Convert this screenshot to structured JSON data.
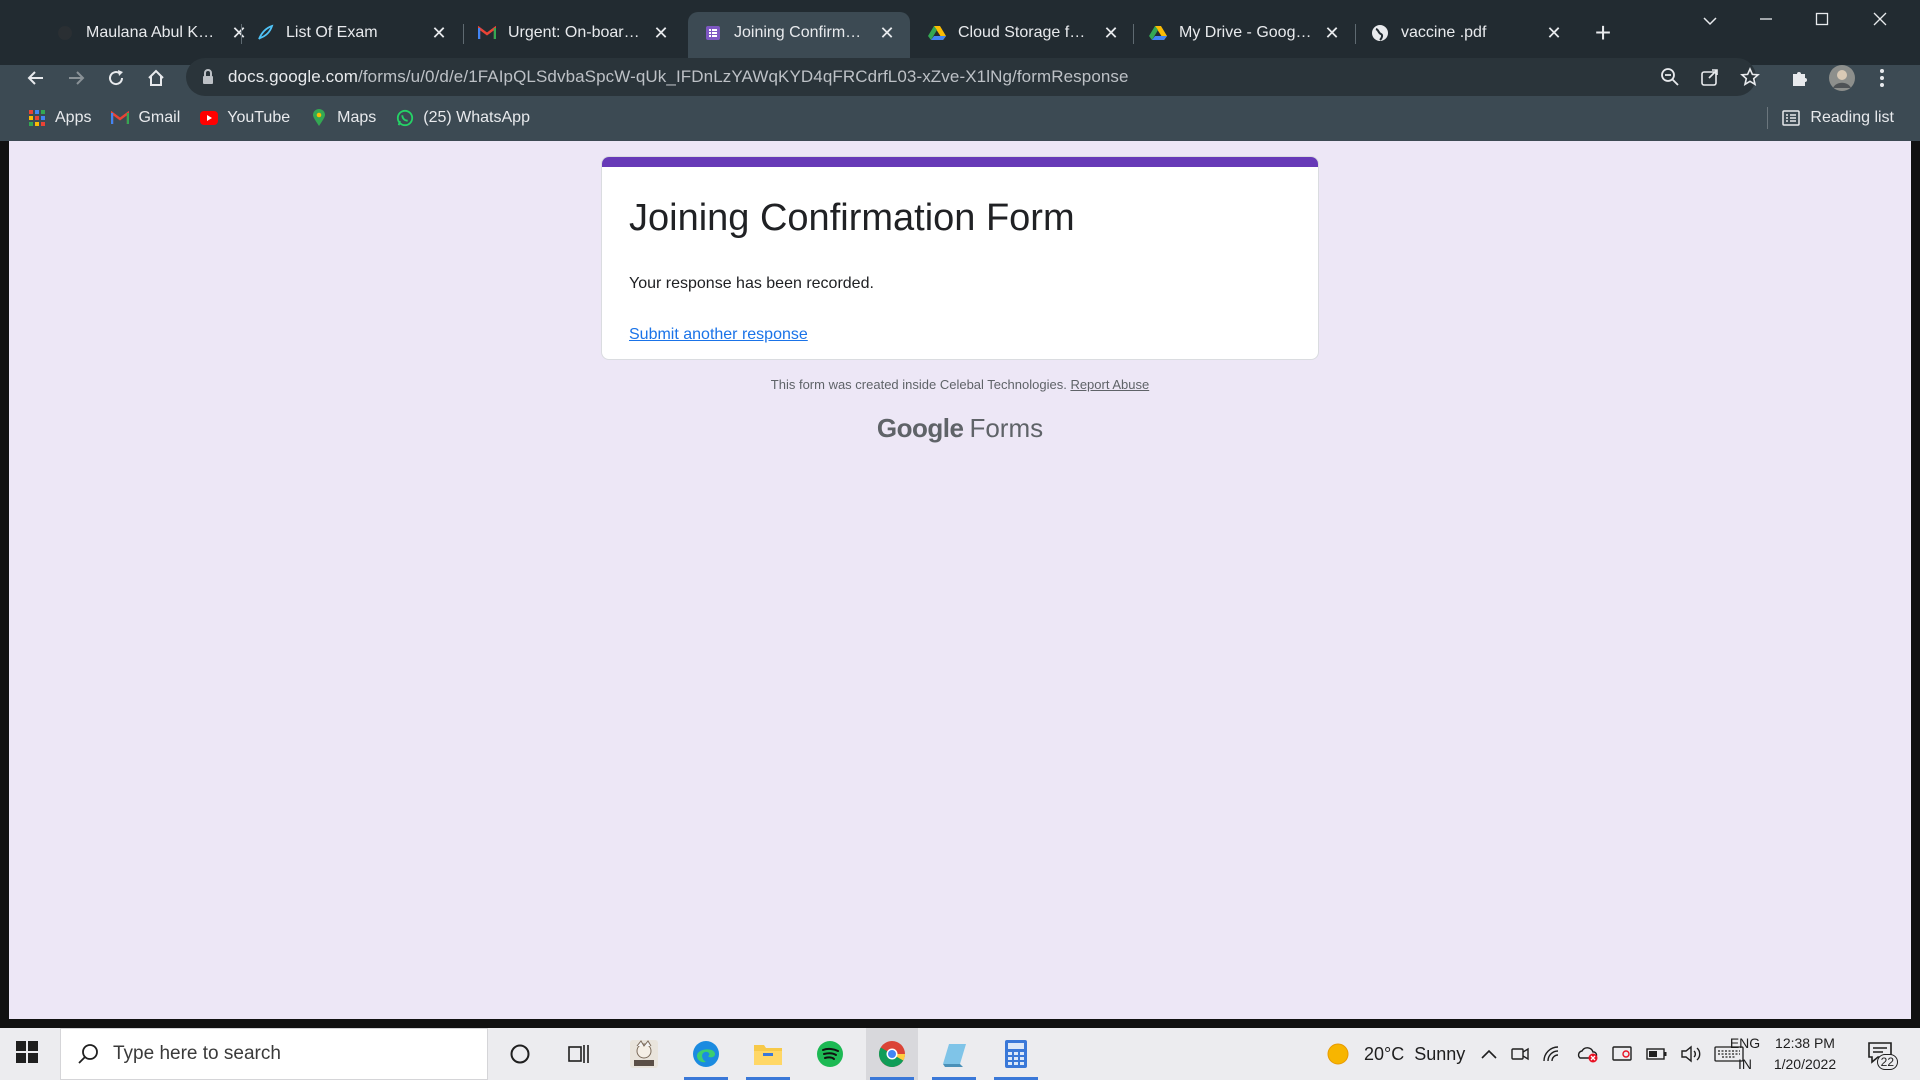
{
  "browser": {
    "tabs": [
      {
        "title": "Maulana Abul Kalam",
        "icon": "generic-site-icon"
      },
      {
        "title": "List Of Exam",
        "icon": "feather-icon"
      },
      {
        "title": "Urgent: On-boarding",
        "icon": "gmail-icon"
      },
      {
        "title": "Joining Confirmation",
        "icon": "google-forms-icon",
        "active": true
      },
      {
        "title": "Cloud Storage for Wo",
        "icon": "google-drive-icon"
      },
      {
        "title": "My Drive - Google Dr",
        "icon": "google-drive-icon"
      },
      {
        "title": "vaccine .pdf",
        "icon": "globe-icon"
      }
    ],
    "close_glyph": "✕",
    "new_tab_glyph": "+",
    "url_host": "docs.google.com",
    "url_path": "/forms/u/0/d/e/1FAIpQLSdvbaSpcW-qUk_IFDnLzYAWqKYD4qFRCdrfL03-xZve-X1lNg/formResponse",
    "bookmarks": [
      {
        "label": "Apps",
        "icon": "apps-grid-icon"
      },
      {
        "label": "Gmail",
        "icon": "gmail-icon"
      },
      {
        "label": "YouTube",
        "icon": "youtube-icon"
      },
      {
        "label": "Maps",
        "icon": "maps-pin-icon"
      },
      {
        "label": "(25) WhatsApp",
        "icon": "whatsapp-icon"
      }
    ],
    "reading_list": "Reading list"
  },
  "form": {
    "title": "Joining Confirmation Form",
    "message": "Your response has been recorded.",
    "submit_another": "Submit another response",
    "footer_text": "This form was created inside Celebal Technologies.",
    "report_abuse": "Report Abuse",
    "brand_google": "Google",
    "brand_forms": "Forms",
    "accent_color": "#673ab7",
    "page_bg": "#ede7f6"
  },
  "taskbar": {
    "search_placeholder": "Type here to search",
    "weather_temp": "20°C",
    "weather_desc": "Sunny",
    "lang_line1": "ENG",
    "lang_line2": "IN",
    "time": "12:38 PM",
    "date": "1/20/2022",
    "notification_count": "22"
  }
}
